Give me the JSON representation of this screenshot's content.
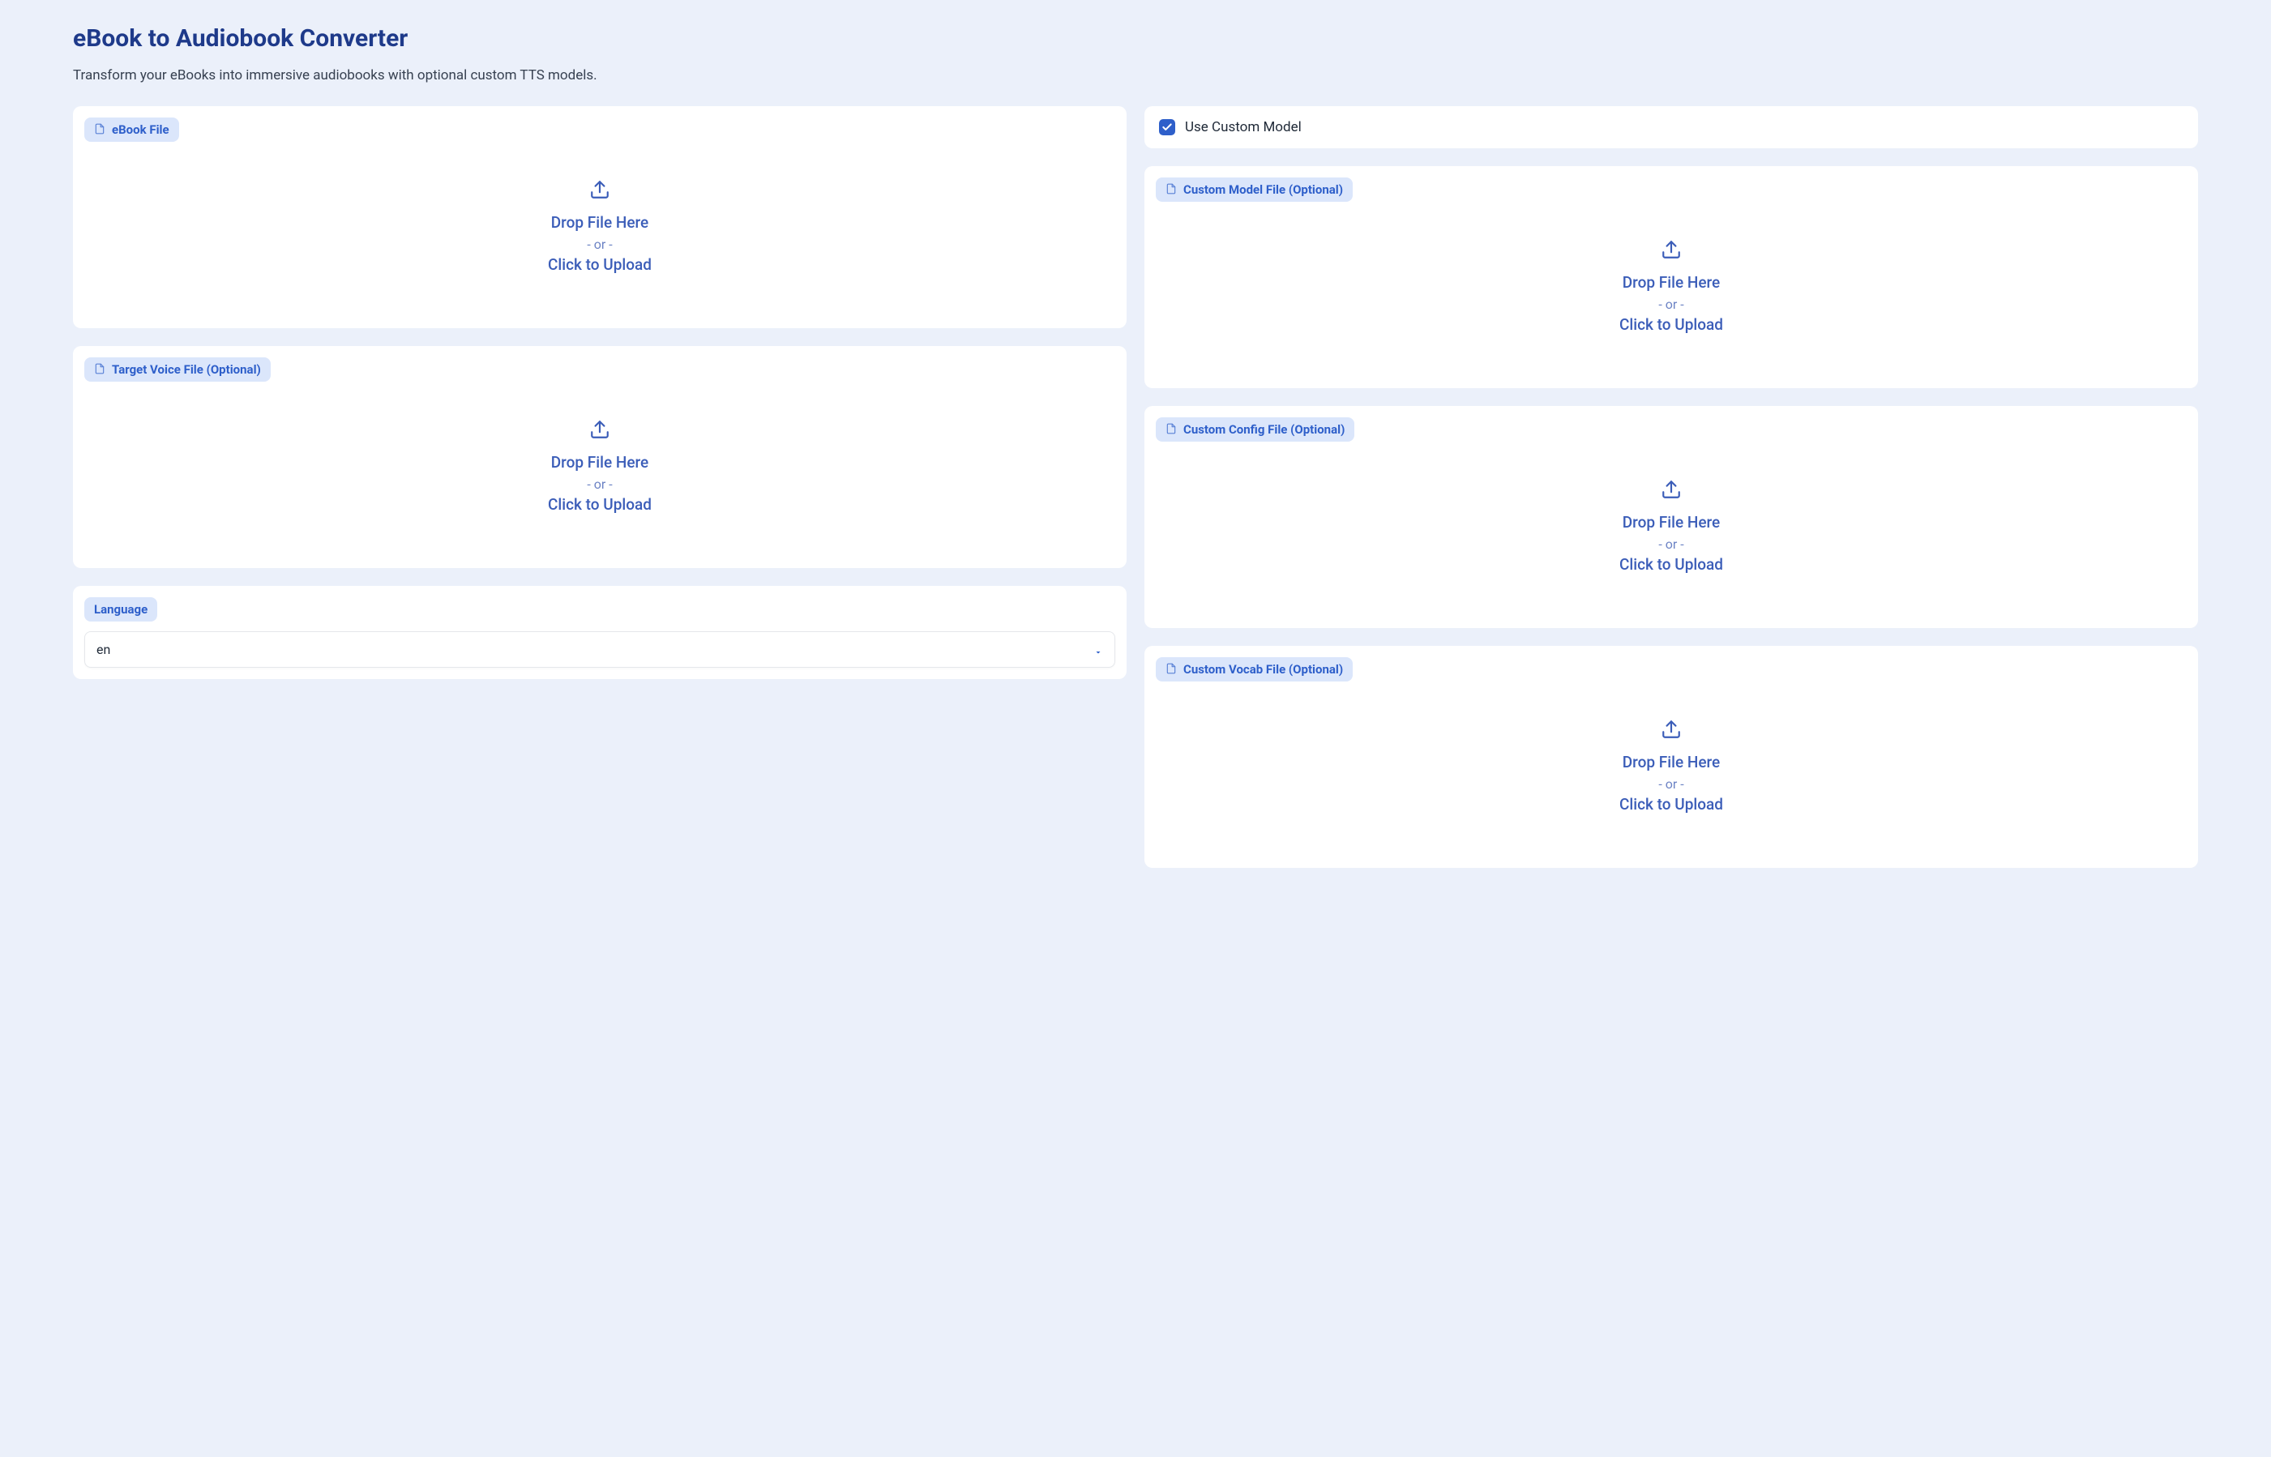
{
  "header": {
    "title": "eBook to Audiobook Converter",
    "subtitle": "Transform your eBooks into immersive audiobooks with optional custom TTS models."
  },
  "dropzone": {
    "line1": "Drop File Here",
    "or": "- or -",
    "line2": "Click to Upload"
  },
  "left": {
    "ebook": {
      "label": "eBook File"
    },
    "voice": {
      "label": "Target Voice File (Optional)"
    },
    "language": {
      "label": "Language",
      "value": "en"
    }
  },
  "right": {
    "checkbox": {
      "label": "Use Custom Model",
      "checked": true
    },
    "model": {
      "label": "Custom Model File (Optional)"
    },
    "config": {
      "label": "Custom Config File (Optional)"
    },
    "vocab": {
      "label": "Custom Vocab File (Optional)"
    }
  }
}
